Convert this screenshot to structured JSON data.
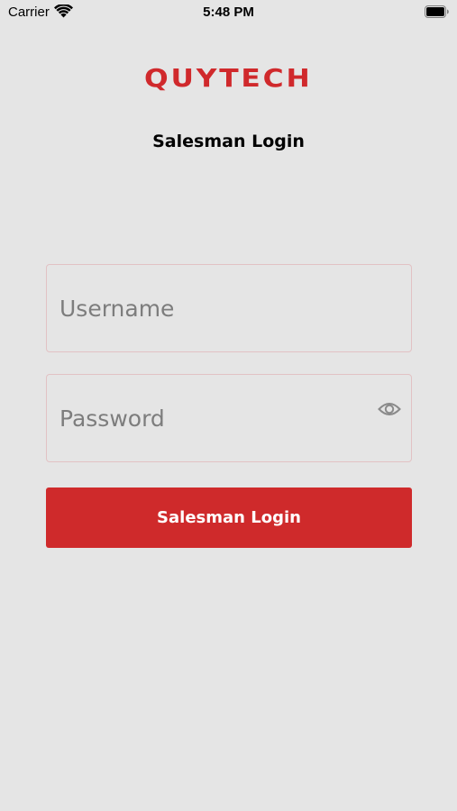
{
  "status_bar": {
    "carrier": "Carrier",
    "time": "5:48 PM",
    "icons": [
      "wifi-icon",
      "battery-icon"
    ]
  },
  "app": {
    "logo_text": "QUYTECH",
    "brand_color": "#d0292c",
    "page_title": "Salesman Login"
  },
  "form": {
    "username": {
      "placeholder": "Username",
      "value": ""
    },
    "password": {
      "placeholder": "Password",
      "value": "",
      "toggle_icon": "eye-icon"
    },
    "submit_label": "Salesman Login"
  },
  "colors": {
    "background": "#e5e5e5",
    "field_border": "#e2c2c4",
    "button": "#cf2a2b"
  }
}
